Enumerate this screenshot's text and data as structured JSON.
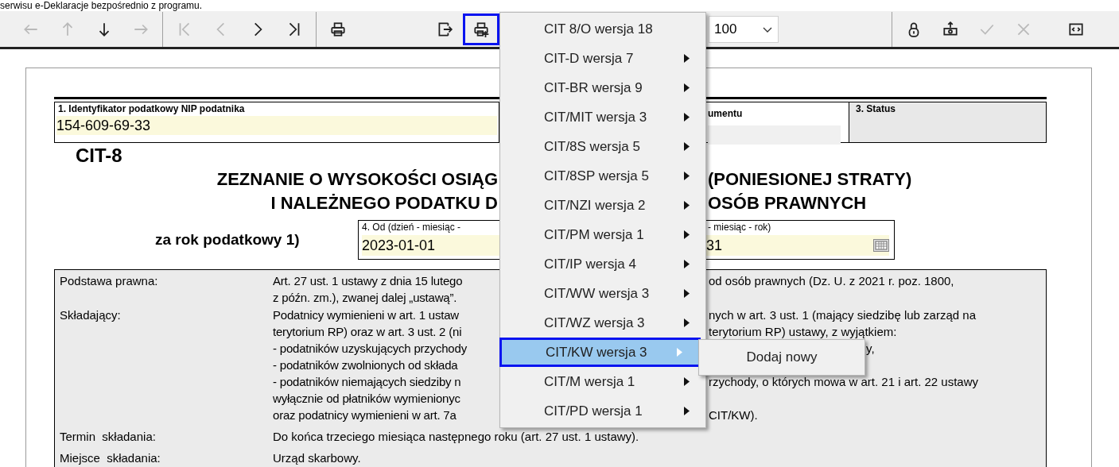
{
  "top_text": "serwisu e-Deklaracje bezpośrednio z programu.",
  "toolbar": {
    "left": [
      {
        "kind": "arrow-left",
        "disabled": true
      },
      {
        "kind": "arrow-up",
        "disabled": true
      },
      {
        "kind": "arrow-down",
        "disabled": false
      },
      {
        "kind": "arrow-right",
        "disabled": true
      },
      {
        "kind": "separator"
      },
      {
        "kind": "first",
        "disabled": true
      },
      {
        "kind": "prev",
        "disabled": true
      },
      {
        "kind": "next",
        "disabled": false
      },
      {
        "kind": "last",
        "disabled": false
      },
      {
        "kind": "separator"
      },
      {
        "kind": "print",
        "disabled": false
      },
      {
        "kind": "gap"
      },
      {
        "kind": "export",
        "disabled": false
      },
      {
        "kind": "print-add",
        "disabled": false,
        "pressed": true
      }
    ],
    "zoom": {
      "value": "100"
    },
    "right": [
      {
        "kind": "separator"
      },
      {
        "kind": "lock",
        "disabled": false
      },
      {
        "kind": "upload",
        "disabled": false
      },
      {
        "kind": "check",
        "disabled": true
      },
      {
        "kind": "cross",
        "disabled": true
      },
      {
        "kind": "gap"
      },
      {
        "kind": "code",
        "disabled": false
      }
    ]
  },
  "menu": {
    "items": [
      {
        "label": "CIT 8/O wersja 18",
        "submenu": false,
        "selected": false
      },
      {
        "label": "CIT-D wersja 7",
        "submenu": true,
        "selected": false
      },
      {
        "label": "CIT-BR wersja 9",
        "submenu": true,
        "selected": false
      },
      {
        "label": "CIT/MIT wersja 3",
        "submenu": true,
        "selected": false
      },
      {
        "label": "CIT/8S wersja 5",
        "submenu": true,
        "selected": false
      },
      {
        "label": "CIT/8SP wersja 5",
        "submenu": true,
        "selected": false
      },
      {
        "label": "CIT/NZI wersja 2",
        "submenu": true,
        "selected": false
      },
      {
        "label": "CIT/PM wersja 1",
        "submenu": true,
        "selected": false
      },
      {
        "label": "CIT/IP wersja 4",
        "submenu": true,
        "selected": false
      },
      {
        "label": "CIT/WW wersja 3",
        "submenu": true,
        "selected": false
      },
      {
        "label": "CIT/WZ wersja 3",
        "submenu": true,
        "selected": false
      },
      {
        "label": "CIT/KW wersja 3",
        "submenu": true,
        "selected": true
      },
      {
        "label": "CIT/M wersja 1",
        "submenu": true,
        "selected": false
      },
      {
        "label": "CIT/PD wersja 1",
        "submenu": true,
        "selected": false
      }
    ],
    "submenu": [
      "Dodaj nowy"
    ]
  },
  "document": {
    "fields_top": [
      {
        "label": "1. Identyfikator podatkowy NIP podatnika",
        "value": "154-609-69-33"
      },
      {
        "label": "umentu"
      },
      {
        "label": "3. Status"
      }
    ],
    "form_code": "CIT-8",
    "title_lines": [
      {
        "left": "ZEZNANIE O WYSOKOŚCI OSIĄG",
        "right": "(PONIESIONEJ STRATY)"
      },
      {
        "left": "I NALEŻNEGO PODATKU D",
        "right": "OSÓB PRAWNYCH"
      }
    ],
    "period_label": "za rok podatkowy 1)",
    "period_from": {
      "label": "4. Od (dzień - miesiąc -",
      "value": "2023-01-01"
    },
    "period_to": {
      "label": "- miesiąc - rok)",
      "value": "31"
    },
    "info": [
      {
        "label": "Podstawa prawna:",
        "lines": [
          {
            "left": "Art. 27 ust. 1 ustawy z dnia 15 lutego",
            "right": "od osób prawnych (Dz. U. z 2021 r. poz. 1800,"
          },
          {
            "left": "z późn. zm.), zwanej dalej „ustawą”."
          }
        ]
      },
      {
        "label": "Składający:",
        "lines": [
          {
            "left": "Podatnicy wymienieni w art. 1 ustaw",
            "right": "nych w art. 3 ust. 1 (mający siedzibę lub zarząd na"
          },
          {
            "left": "terytorium RP) oraz w art. 3 ust. 2 (ni",
            "right": "terytorium RP) ustawy, z wyjątkiem:"
          },
          {
            "left": "- podatników uzyskujących przychody",
            "far": "y,"
          },
          {
            "left": "- podatników zwolnionych od składa"
          },
          {
            "left": "- podatników niemających siedziby n",
            "right": "rzychody, o których mowa w art. 21 i art. 22 ustawy"
          },
          {
            "left": "wyłącznie od płatników wymienionyc"
          },
          {
            "left": "oraz podatnicy wymienieni w art. 7a",
            "right": "CIT/KW)."
          }
        ]
      },
      {
        "label": "Termin  składania:",
        "lines": [
          {
            "full": "Do końca trzeciego miesiąca następnego roku (art. 27 ust. 1 ustawy)."
          }
        ]
      },
      {
        "label": "Miejsce  składania:",
        "lines": [
          {
            "full": "Urząd skarbowy."
          }
        ]
      }
    ]
  }
}
